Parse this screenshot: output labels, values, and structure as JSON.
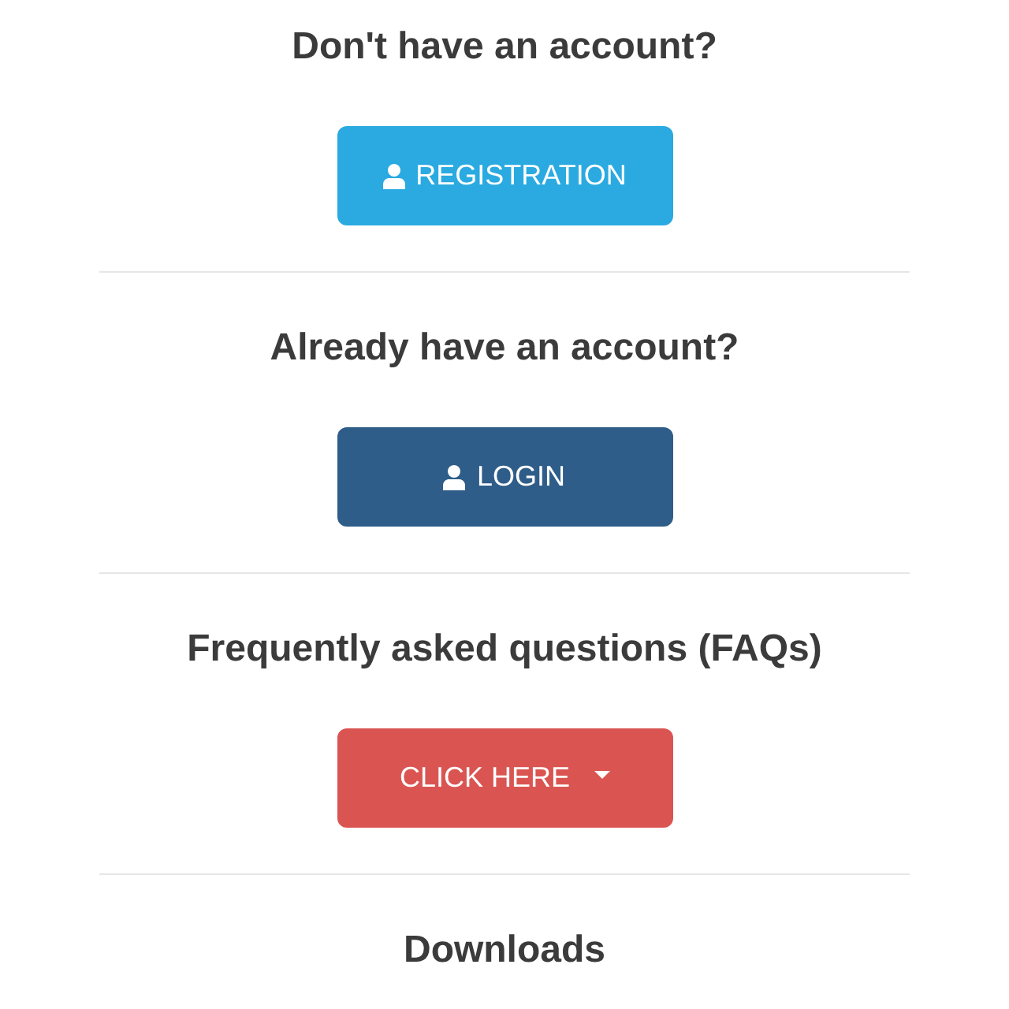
{
  "sections": [
    {
      "heading": "Don't have an account?",
      "button": {
        "label": "REGISTRATION",
        "kind": "account",
        "color": "#2aaae0"
      }
    },
    {
      "heading": "Already have an account?",
      "button": {
        "label": "LOGIN",
        "kind": "account",
        "color": "#2f5d89"
      }
    },
    {
      "heading": "Frequently asked questions (FAQs)",
      "button": {
        "label": "CLICK HERE",
        "kind": "dropdown",
        "color": "#da5551"
      }
    },
    {
      "heading": "Downloads"
    }
  ]
}
